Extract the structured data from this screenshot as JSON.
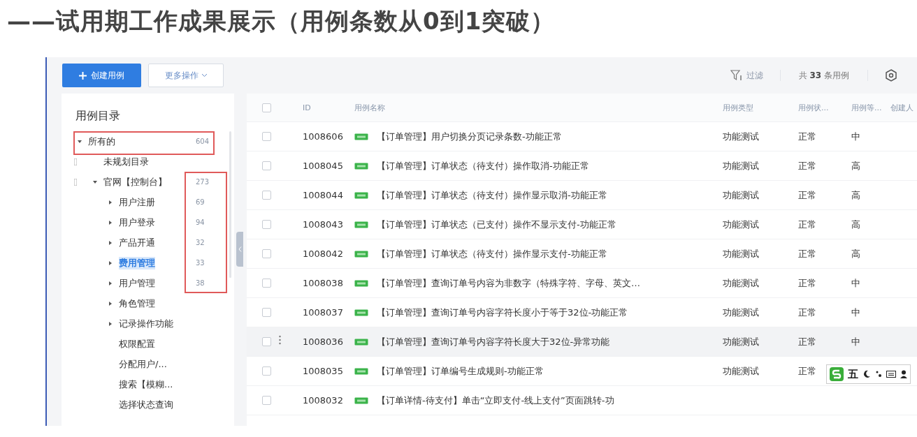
{
  "slide_title": "——试用期工作成果展示（用例条数从0到1突破）",
  "toolbar": {
    "create_button": "创建用例",
    "more_button": "更多操作",
    "filter_button": "过滤",
    "total_prefix": "共",
    "total_count": "33",
    "total_suffix": "条用例"
  },
  "sidebar": {
    "title": "用例目录",
    "tree": [
      {
        "label": "所有的",
        "count": "604",
        "kind": "branch",
        "expanded": true,
        "selected": false,
        "row_framed": true,
        "children": [
          {
            "label": "未规划目录",
            "kind": "leaf",
            "selected": false
          },
          {
            "label": "官网【控制台】",
            "count": "273",
            "kind": "branch",
            "expanded": true,
            "selected": false,
            "count_framed": true,
            "children": [
              {
                "label": "用户注册",
                "count": "69",
                "kind": "branch",
                "expanded": false,
                "selected": false,
                "count_framed": true
              },
              {
                "label": "用户登录",
                "count": "94",
                "kind": "branch",
                "expanded": false,
                "selected": false,
                "count_framed": true
              },
              {
                "label": "产品开通",
                "count": "32",
                "kind": "branch",
                "expanded": false,
                "selected": false,
                "count_framed": true
              },
              {
                "label": "费用管理",
                "count": "33",
                "kind": "branch",
                "expanded": false,
                "selected": true,
                "count_framed": true
              },
              {
                "label": "用户管理",
                "count": "38",
                "kind": "branch",
                "expanded": false,
                "selected": false,
                "count_framed": true
              },
              {
                "label": "角色管理",
                "kind": "branch",
                "expanded": false,
                "selected": false
              },
              {
                "label": "记录操作功能",
                "kind": "branch",
                "expanded": false,
                "selected": false
              },
              {
                "label": "权限配置",
                "kind": "leaf",
                "selected": false
              },
              {
                "label": "分配用户/...",
                "kind": "leaf",
                "selected": false
              },
              {
                "label": "搜索【模糊...",
                "kind": "leaf",
                "selected": false
              },
              {
                "label": "选择状态查询",
                "kind": "leaf",
                "selected": false
              }
            ]
          }
        ]
      }
    ]
  },
  "table": {
    "select_all_checked": false,
    "columns": [
      "ID",
      "用例名称",
      "用例类型",
      "用例状...",
      "用例等...",
      "创建人"
    ],
    "rows": [
      {
        "id": "1008606",
        "name": "【订单管理】用户切换分页记录条数-功能正常",
        "type": "功能测试",
        "status": "正常",
        "level": "中",
        "checked": false,
        "hovered": false
      },
      {
        "id": "1008045",
        "name": "【订单管理】订单状态（待支付）操作取消-功能正常",
        "type": "功能测试",
        "status": "正常",
        "level": "高",
        "checked": false,
        "hovered": false
      },
      {
        "id": "1008044",
        "name": "【订单管理】订单状态（待支付）操作显示取消-功能正常",
        "type": "功能测试",
        "status": "正常",
        "level": "高",
        "checked": false,
        "hovered": false
      },
      {
        "id": "1008043",
        "name": "【订单管理】订单状态（已支付）操作不显示支付-功能正常",
        "type": "功能测试",
        "status": "正常",
        "level": "高",
        "checked": false,
        "hovered": false
      },
      {
        "id": "1008042",
        "name": "【订单管理】订单状态（待支付）操作显示支付-功能正常",
        "type": "功能测试",
        "status": "正常",
        "level": "高",
        "checked": false,
        "hovered": false
      },
      {
        "id": "1008038",
        "name": "【订单管理】查询订单号内容为非数字（特殊字符、字母、英文…",
        "type": "功能测试",
        "status": "正常",
        "level": "中",
        "checked": false,
        "hovered": false
      },
      {
        "id": "1008037",
        "name": "【订单管理】查询订单号内容字符长度小于等于32位-功能正常",
        "type": "功能测试",
        "status": "正常",
        "level": "中",
        "checked": false,
        "hovered": false
      },
      {
        "id": "1008036",
        "name": "【订单管理】查询订单号内容字符长度大于32位-异常功能",
        "type": "功能测试",
        "status": "正常",
        "level": "中",
        "checked": false,
        "hovered": true
      },
      {
        "id": "1008035",
        "name": "【订单管理】订单编号生成规则-功能正常",
        "type": "功能测试",
        "status": "正常",
        "checked": false,
        "hovered": false
      },
      {
        "id": "1008032",
        "name": "【订单详情-待支付】单击“立即支付-线上支付”页面跳转-功",
        "checked": false,
        "hovered": false
      }
    ]
  },
  "ime_bar": {
    "mode": "五"
  }
}
